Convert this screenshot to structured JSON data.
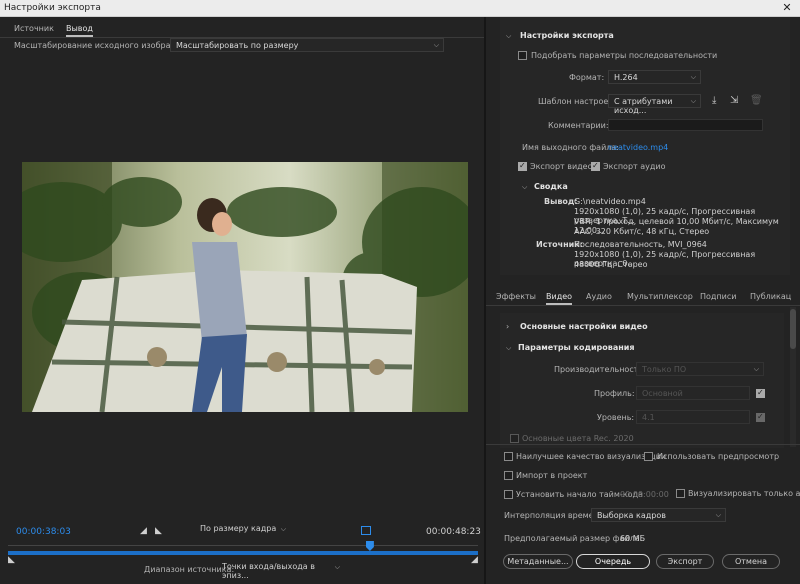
{
  "window": {
    "title": "Настройки экспорта",
    "close_glyph": "✕"
  },
  "source_panel": {
    "tabs": [
      "Источник",
      "Вывод"
    ],
    "scaling_label": "Масштабирование исходного изображения:",
    "scaling_value": "Масштабировать по размеру",
    "timecode_in": "00:00:38:03",
    "timecode_out": "00:00:48:23",
    "fit_value": "По размеру кадра",
    "range_label": "Диапазон источника:",
    "range_value": "Точки входа/выхода в эпиз...",
    "playhead_fraction": 0.77,
    "in_point_glyph": "◢",
    "out_point_glyph": "◣"
  },
  "export_settings": {
    "header": "Настройки экспорта",
    "match_sequence": "Подобрать параметры последовательности",
    "format_label": "Формат:",
    "format_value": "H.264",
    "preset_label": "Шаблон настроек:",
    "preset_value": "С атрибутами исход...",
    "comments_label": "Комментарии:",
    "output_name_label": "Имя выходного файла:",
    "output_name_value": "neatvideo.mp4",
    "export_video": "Экспорт видео",
    "export_audio": "Экспорт аудио",
    "summary_header": "Сводка",
    "output_label": "Вывод:",
    "output_lines": [
      "G:\\neatvideo.mp4",
      "1920x1080 (1,0), 25 кадр/с, Прогрессивная развертка, Т...",
      "VBR, 1 проход, целевой 10,00 Мбит/с, Максимум 12,00...",
      "AAC, 320 Кбит/с, 48 кГц, Стерео"
    ],
    "source_label": "Источник:",
    "source_lines": [
      "Последовательность, MVI_0964",
      "1920x1080 (1,0), 25 кадр/с, Прогрессивная развертка, 0...",
      "48000 Гц, Стерео"
    ]
  },
  "settings_tabs": [
    "Эффекты",
    "Видео",
    "Аудио",
    "Мультиплексор",
    "Подписи",
    "Публикац"
  ],
  "video": {
    "basic_header": "Основные настройки видео",
    "encoding_header": "Параметры кодирования",
    "performance_label": "Производительность:",
    "performance_value": "Только ПО",
    "profile_label": "Профиль:",
    "profile_value": "Основной",
    "level_label": "Уровень:",
    "level_value": "4.1",
    "rec2020_label": "Основные цвета Rec. 2020"
  },
  "bottom": {
    "max_render": "Наилучшее качество визуализации",
    "use_previews": "Использовать предпросмотр",
    "import_project": "Импорт в проект",
    "set_timecode": "Установить начало тайм-кода",
    "timecode_value": "00:00:00:00",
    "alpha_only": "Визуализировать только альфа-к",
    "interp_label": "Интерполяция времени:",
    "interp_value": "Выборка кадров",
    "filesize_label": "Предполагаемый размер файла:",
    "filesize_value": "60 МБ",
    "metadata_btn": "Метаданные...",
    "queue_btn": "Очередь",
    "export_btn": "Экспорт",
    "cancel_btn": "Отмена"
  },
  "colors": {
    "accent": "#2d8ceb",
    "panel": "#232323",
    "background": "#1e1e1e"
  }
}
